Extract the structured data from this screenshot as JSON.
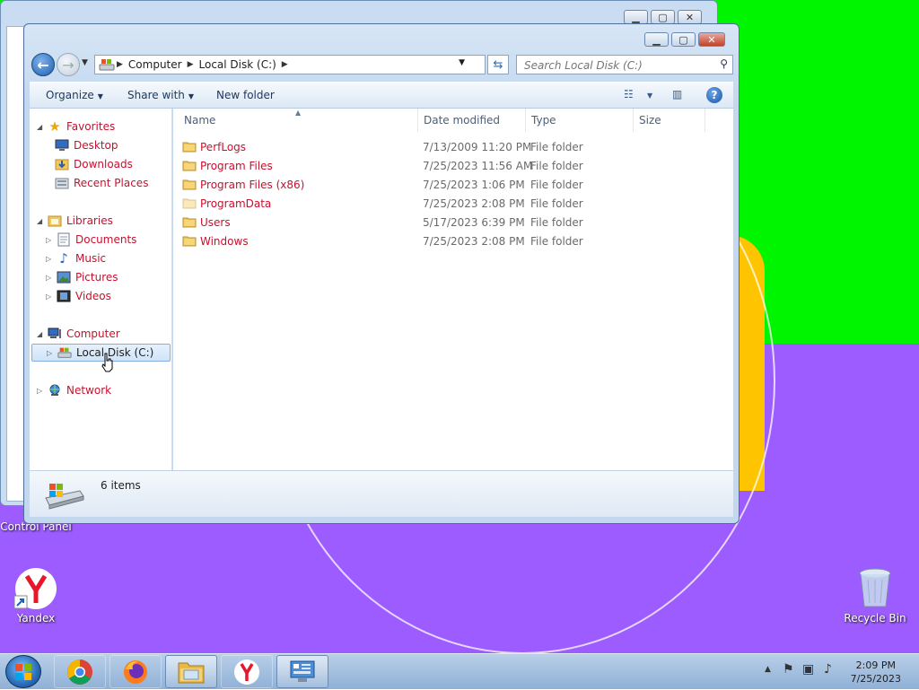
{
  "desktop": {
    "icons": [
      {
        "label": "Control Panel"
      },
      {
        "label": "Yandex"
      },
      {
        "label": "Recycle Bin"
      }
    ]
  },
  "explorer": {
    "address": {
      "crumbs": [
        "Computer",
        "Local Disk (C:)"
      ]
    },
    "search": {
      "placeholder": "Search Local Disk (C:)"
    },
    "commands": {
      "organize": "Organize",
      "share_with": "Share with",
      "new_folder": "New folder"
    },
    "nav": {
      "favorites": "Favorites",
      "desktop": "Desktop",
      "downloads": "Downloads",
      "recent_places": "Recent Places",
      "libraries": "Libraries",
      "documents": "Documents",
      "music": "Music",
      "pictures": "Pictures",
      "videos": "Videos",
      "computer": "Computer",
      "local_disk": "Local Disk (C:)",
      "network": "Network"
    },
    "columns": {
      "name": "Name",
      "date_modified": "Date modified",
      "type": "Type",
      "size": "Size"
    },
    "files": [
      {
        "name": "PerfLogs",
        "date": "7/13/2009 11:20 PM",
        "type": "File folder"
      },
      {
        "name": "Program Files",
        "date": "7/25/2023 11:56 AM",
        "type": "File folder"
      },
      {
        "name": "Program Files (x86)",
        "date": "7/25/2023 1:06 PM",
        "type": "File folder"
      },
      {
        "name": "ProgramData",
        "date": "7/25/2023 2:08 PM",
        "type": "File folder"
      },
      {
        "name": "Users",
        "date": "5/17/2023 6:39 PM",
        "type": "File folder"
      },
      {
        "name": "Windows",
        "date": "7/25/2023 2:08 PM",
        "type": "File folder"
      }
    ],
    "details": {
      "item_count": "6 items"
    }
  },
  "taskbar": {
    "clock_time": "2:09 PM",
    "clock_date": "7/25/2023"
  },
  "colors": {
    "accent": "#1f5fae",
    "link_red": "#c8102e",
    "desktop_green": "#00f500",
    "desktop_purple": "#9d5cff",
    "desktop_yellow": "#ffc400"
  }
}
